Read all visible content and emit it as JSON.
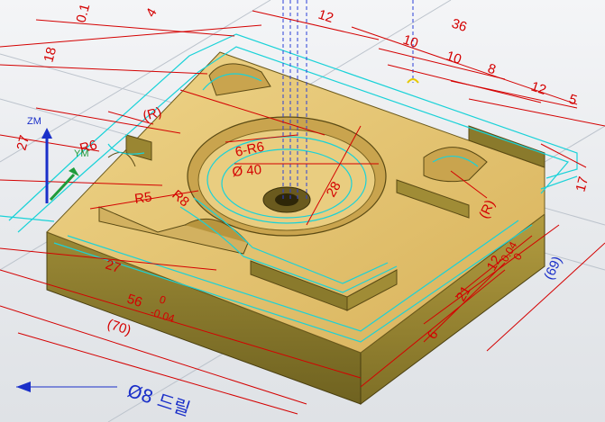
{
  "viewport": {
    "axes": {
      "z_label": "ZM",
      "y_label": "YM"
    },
    "dimensions": {
      "d_0_1": "0.1",
      "d_4": "4",
      "d_12": "12",
      "d_36": "36",
      "d_10a": "10",
      "d_10b": "10",
      "d_8": "8",
      "d_12b": "12",
      "d_5": "5",
      "d_18": "18",
      "d_27a": "27",
      "d_r6": "R6",
      "d_r_paren_a": "(R)",
      "d_6r6": "6-R6",
      "d_dia40": "Ø 40",
      "d_28": "28",
      "d_r5": "R5",
      "d_r8": "R8",
      "d_r_paren_b": "(R)",
      "d_17": "17",
      "d_27b": "27",
      "d_56": "56",
      "d_56_tol_upper": "0",
      "d_56_tol_lower": "-0.04",
      "d_70": "(70)",
      "d_12_tol_base": "12",
      "d_12_tol_upper": "0.04",
      "d_12_tol_lower": "0",
      "d_21": "21",
      "d_6": "6",
      "d_69": "(69)"
    },
    "tool_label": "Ø8 드릴",
    "colors": {
      "part_top": "#e4c46c",
      "part_side_left": "#8a7a2c",
      "part_side_right": "#a08c36",
      "dimension": "#d40000",
      "toolpath": "#19d2d8",
      "annotation": "#1a2fc9"
    }
  }
}
